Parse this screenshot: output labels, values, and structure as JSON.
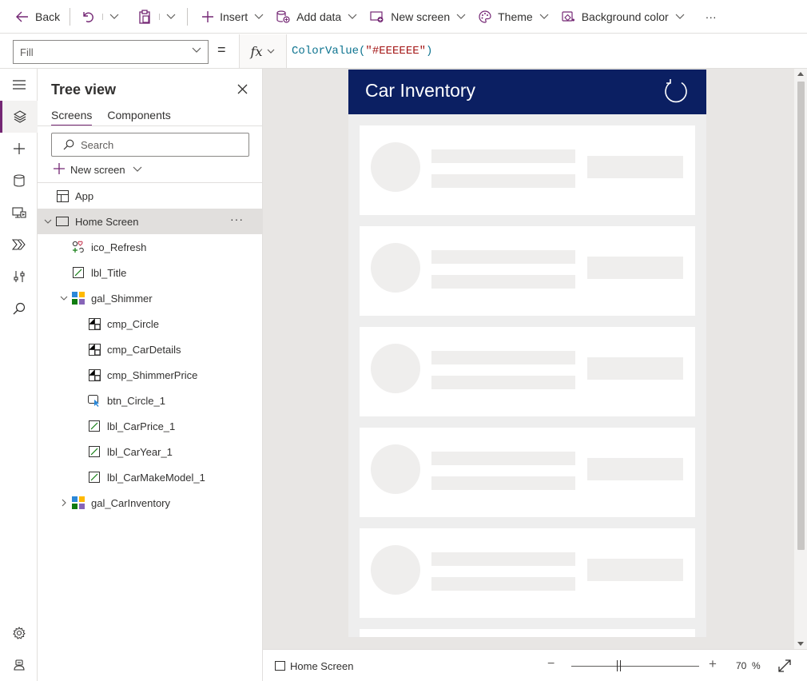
{
  "toolbar": {
    "back_label": "Back",
    "insert_label": "Insert",
    "add_data_label": "Add data",
    "new_screen_label": "New screen",
    "theme_label": "Theme",
    "background_color_label": "Background color",
    "more_label": "···"
  },
  "formula_bar": {
    "property": "Fill",
    "equals": "=",
    "fx_label": "fx",
    "formula_fn": "ColorValue(",
    "formula_str": "\"#EEEEEE\"",
    "formula_end": ")"
  },
  "tree_view": {
    "title": "Tree view",
    "tabs": [
      {
        "label": "Screens",
        "active": true
      },
      {
        "label": "Components",
        "active": false
      }
    ],
    "search_placeholder": "Search",
    "new_screen_label": "New screen",
    "more_label": "···",
    "nodes": [
      {
        "label": "App",
        "icon": "app-icon",
        "level": 0
      },
      {
        "label": "Home Screen",
        "icon": "screen-icon",
        "level": 0,
        "expanded": true,
        "selected": true
      },
      {
        "label": "ico_Refresh",
        "icon": "icons-control-icon",
        "level": 1
      },
      {
        "label": "lbl_Title",
        "icon": "label-icon",
        "level": 1
      },
      {
        "label": "gal_Shimmer",
        "icon": "gallery-icon",
        "level": 1,
        "expanded": true
      },
      {
        "label": "cmp_Circle",
        "icon": "component-icon",
        "level": 2
      },
      {
        "label": "cmp_CarDetails",
        "icon": "component-icon",
        "level": 2
      },
      {
        "label": "cmp_ShimmerPrice",
        "icon": "component-icon",
        "level": 2
      },
      {
        "label": "btn_Circle_1",
        "icon": "button-icon",
        "level": 2
      },
      {
        "label": "lbl_CarPrice_1",
        "icon": "label-icon",
        "level": 2
      },
      {
        "label": "lbl_CarYear_1",
        "icon": "label-icon",
        "level": 2
      },
      {
        "label": "lbl_CarMakeModel_1",
        "icon": "label-icon",
        "level": 2
      },
      {
        "label": "gal_CarInventory",
        "icon": "gallery-icon",
        "level": 1,
        "expanded": false
      }
    ]
  },
  "app_preview": {
    "title": "Car Inventory",
    "header_color": "#0b1f62",
    "background_color": "#EEEEEE",
    "placeholder_cards": 5
  },
  "status_bar": {
    "screen_label": "Home Screen",
    "zoom_value": "70",
    "zoom_unit": "%",
    "zoom_level": 0.7
  },
  "colors": {
    "accent": "#742774",
    "selected_row": "#e1dfdd",
    "canvas_bg": "#e8e6e4"
  }
}
